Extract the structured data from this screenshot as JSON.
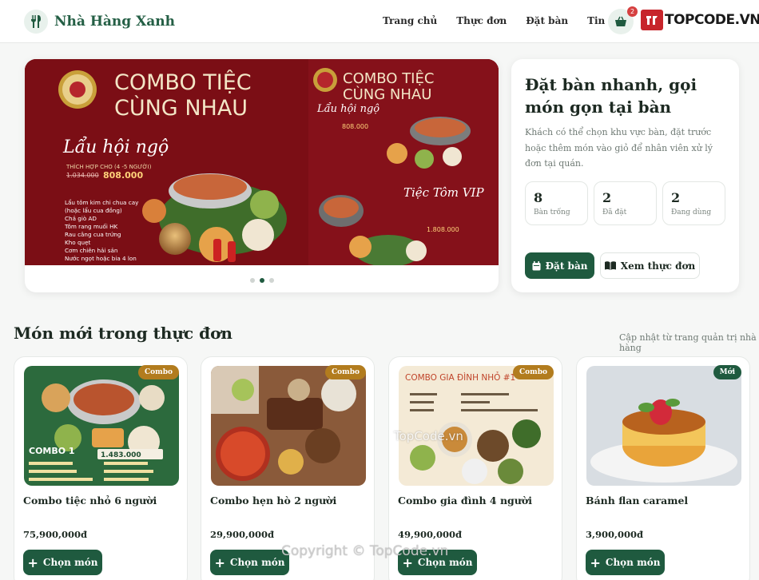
{
  "brand": {
    "name": "Nhà Hàng Xanh",
    "icon": "fork-knife-icon"
  },
  "nav": [
    {
      "label": "Trang chủ"
    },
    {
      "label": "Thực đơn"
    },
    {
      "label": "Đặt bàn"
    },
    {
      "label": "Tin tức"
    }
  ],
  "cart": {
    "count": "2",
    "icon": "basket-icon"
  },
  "watermark": {
    "logo_text": "TOPCODE.VN",
    "center_text": "TopCode.vn",
    "copyright": "Copyright © TopCode.vn"
  },
  "hero": {
    "slides_total": 3,
    "active_slide": 2,
    "banner": {
      "title_line1": "COMBO TIỆC",
      "title_line2": "CÙNG NHAU",
      "left_name": "Lẩu hội ngộ",
      "left_suit": "THÍCH HỢP CHO (4 -5 NGƯỜI)",
      "left_old_price": "1.034.000",
      "left_price": "808.000",
      "left_items": [
        "Lẩu tôm kim chi chua cay",
        "(hoặc lẩu cua đồng)",
        "Chả giò AD",
        "Tôm rang muối HK",
        "Rau câng cua trứng",
        "Kho quẹt",
        "Cơm chiên hải sản",
        "Nước ngọt hoặc bia 4 lon"
      ],
      "right_title_line1": "COMBO TIỆC",
      "right_title_line2": "CÙNG NHAU",
      "right_name1": "Lẩu hội ngộ",
      "right_price1": "808.000",
      "right_name2": "Tiệc Tôm VIP",
      "right_price2": "1.808.000"
    }
  },
  "info": {
    "title": "Đặt bàn nhanh, gọi món gọn tại bàn",
    "description": "Khách có thể chọn khu vực bàn, đặt trước hoặc thêm món vào giỏ để nhân viên xử lý đơn tại quán.",
    "stats": [
      {
        "value": "8",
        "label": "Bàn trống"
      },
      {
        "value": "2",
        "label": "Đã đặt"
      },
      {
        "value": "2",
        "label": "Đang dùng"
      }
    ],
    "primary_button": "Đặt bàn",
    "secondary_button": "Xem thực đơn"
  },
  "section": {
    "title": "Món mới trong thực đơn",
    "subtitle": "Cập nhật từ trang quản trị nhà hàng"
  },
  "menu_items": [
    {
      "name": "Combo tiệc nhỏ 6 người",
      "price": "75,900,000đ",
      "tag": "Combo",
      "button": "Chọn món",
      "img_label": "COMBO 1",
      "img_price": "1.483.000"
    },
    {
      "name": "Combo hẹn hò 2 người",
      "price": "29,900,000đ",
      "tag": "Combo",
      "button": "Chọn món"
    },
    {
      "name": "Combo gia đình 4 người",
      "price": "49,900,000đ",
      "tag": "Combo",
      "button": "Chọn món",
      "img_label": "COMBO GIA ĐÌNH NHỎ #1"
    },
    {
      "name": "Bánh flan caramel",
      "price": "3,900,000đ",
      "tag": "Mới",
      "button": "Chọn món"
    }
  ],
  "colors": {
    "primary": "#1f5a3f",
    "combo_tag": "#b27c1e",
    "banner": "#7a0d14"
  }
}
